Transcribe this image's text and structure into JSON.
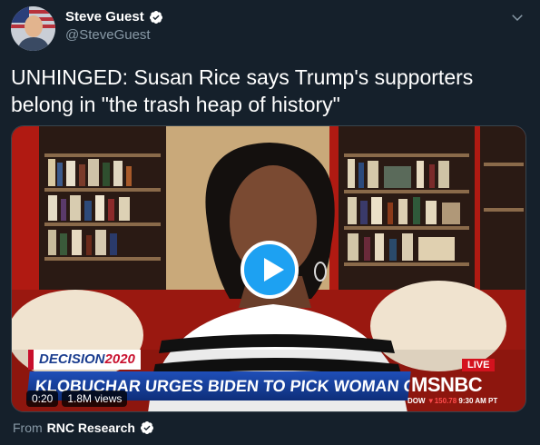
{
  "author": {
    "display_name": "Steve Guest",
    "handle": "@SteveGuest",
    "verified": true,
    "avatar_icon": "avatar-photo-flag-background"
  },
  "tweet": {
    "text": "UNHINGED: Susan Rice says Trump's supporters belong in \"the trash heap of history\""
  },
  "video": {
    "elapsed": "0:20",
    "views": "1.8M views",
    "play_icon": "play-icon",
    "overlay": {
      "decision_prefix": "DECISION",
      "decision_year": "2020",
      "headline": "KLOBUCHAR URGES BIDEN TO PICK WOMAN OF COLOR FOR VP",
      "live_label": "LIVE",
      "network": "MSNBC",
      "ticker_index": "DOW",
      "ticker_change": "▼150.78",
      "ticker_time": "9:30 AM PT"
    }
  },
  "source": {
    "prefix": "From",
    "name": "RNC Research",
    "verified": true
  },
  "colors": {
    "background": "#15202b",
    "accent": "#1da1f2",
    "secondary_text": "#8899a6",
    "live_red": "#d4121e"
  }
}
